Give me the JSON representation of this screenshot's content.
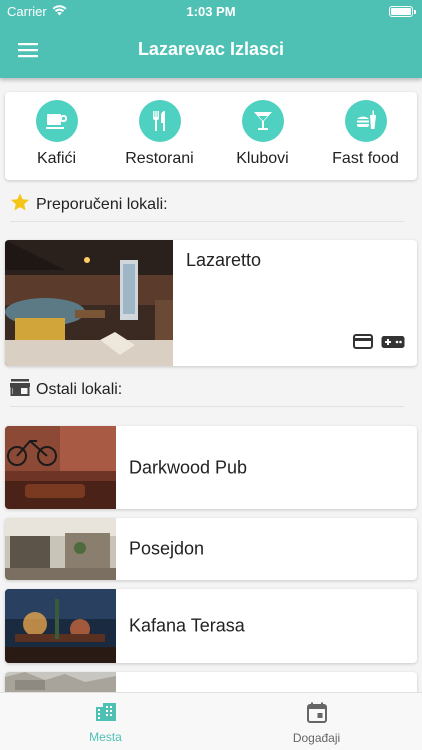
{
  "status_bar": {
    "carrier": "Carrier",
    "time": "1:03 PM"
  },
  "app_bar": {
    "title": "Lazarevac Izlasci",
    "menu_icon": "hamburger-menu-icon"
  },
  "categories": [
    {
      "label": "Kafići",
      "icon": "coffee-cup-icon"
    },
    {
      "label": "Restorani",
      "icon": "fork-knife-icon"
    },
    {
      "label": "Klubovi",
      "icon": "cocktail-glass-icon"
    },
    {
      "label": "Fast food",
      "icon": "fastfood-icon"
    }
  ],
  "featured_section": {
    "title": "Preporučeni lokali:",
    "icon": "star-icon"
  },
  "featured": {
    "name": "Lazaretto",
    "feature_icons": [
      "credit-card-icon",
      "gamepad-icon"
    ]
  },
  "others_section": {
    "title": "Ostali lokali:",
    "icon": "store-icon"
  },
  "venues": [
    {
      "name": "Darkwood Pub"
    },
    {
      "name": "Posejdon"
    },
    {
      "name": "Kafana Terasa"
    },
    {
      "name": ""
    }
  ],
  "tabs": [
    {
      "label": "Mesta",
      "icon": "city-buildings-icon",
      "active": true
    },
    {
      "label": "Događaji",
      "icon": "calendar-icon",
      "active": false
    }
  ],
  "colors": {
    "primary": "#4fc1b4",
    "accent_circle": "#4fd1c1",
    "star": "#f5c518"
  }
}
